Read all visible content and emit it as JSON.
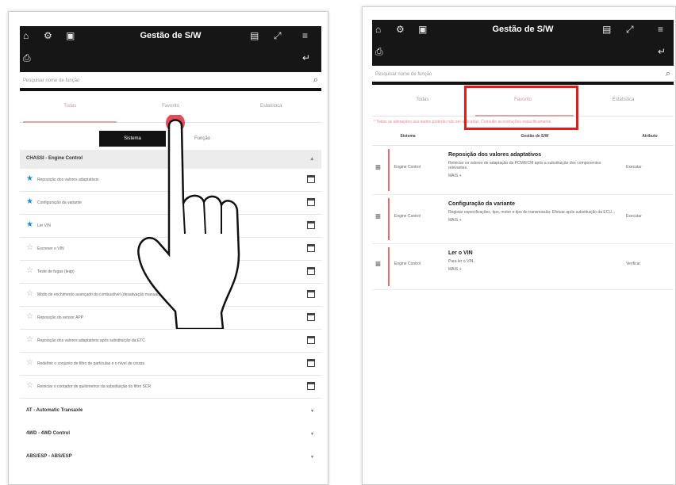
{
  "app": {
    "title": "Gestão de S/W",
    "search_placeholder": "Pesquisar nome de função"
  },
  "tabs": [
    "Todas",
    "Favorito",
    "Estatística"
  ],
  "segment": {
    "left": "Sistema",
    "right": "Função"
  },
  "left_panel": {
    "group_open": "CHASSI - Engine Control",
    "items": [
      {
        "label": "Reposição dos valores adaptativos",
        "starred": true
      },
      {
        "label": "Configuração da variante",
        "starred": true
      },
      {
        "label": "Ler VIN",
        "starred": true
      },
      {
        "label": "Escrever o VIN",
        "starred": false
      },
      {
        "label": "Teste de fugas (leap)",
        "starred": false
      },
      {
        "label": "Modo de enchimento avançado do combustível (desativação manual)",
        "starred": false
      },
      {
        "label": "Reposição do sensor APP",
        "starred": false
      },
      {
        "label": "Reposição dos valores adaptativos após substituição da ETC",
        "starred": false
      },
      {
        "label": "Redefinir o conjunto de filtro de partículas e o nível de cinzas",
        "starred": false
      },
      {
        "label": "Reiniciar o contador de quilómetros da substituição do filtro SCR",
        "starred": false
      }
    ],
    "groups_collapsed": [
      "AT - Automatic Transaxle",
      "4WD - 4WD Control",
      "ABS/ESP - ABS/ESP"
    ]
  },
  "right_panel": {
    "notice": "* Todas as alterações aos dados poderão não ser aplicadas. Consulte as instruções especificamente.",
    "columns": [
      "Sistema",
      "Gestão de S/W",
      "Atributo"
    ],
    "rows": [
      {
        "system": "Engine Control",
        "title": "Reposição dos valores adaptativos",
        "desc": "Reiniciar os valores de adaptação da PCM/ECM após a substituição dos componentes relevantes.",
        "more": "MAIS +",
        "attr": "Executar"
      },
      {
        "system": "Engine Control",
        "title": "Configuração da variante",
        "desc": "Registar especificações, tipo, motor e tipo de transmissão. Efetuar após substituição da ECU...",
        "more": "MAIS +",
        "attr": "Executar"
      },
      {
        "system": "Engine Control",
        "title": "Ler o VIN",
        "desc": "Para ler o VIN.",
        "more": "MAIS +",
        "attr": "Verificar"
      }
    ]
  },
  "colors": {
    "accent": "#e21b1b",
    "star": "#1e8ed8",
    "topbar": "#161616"
  }
}
